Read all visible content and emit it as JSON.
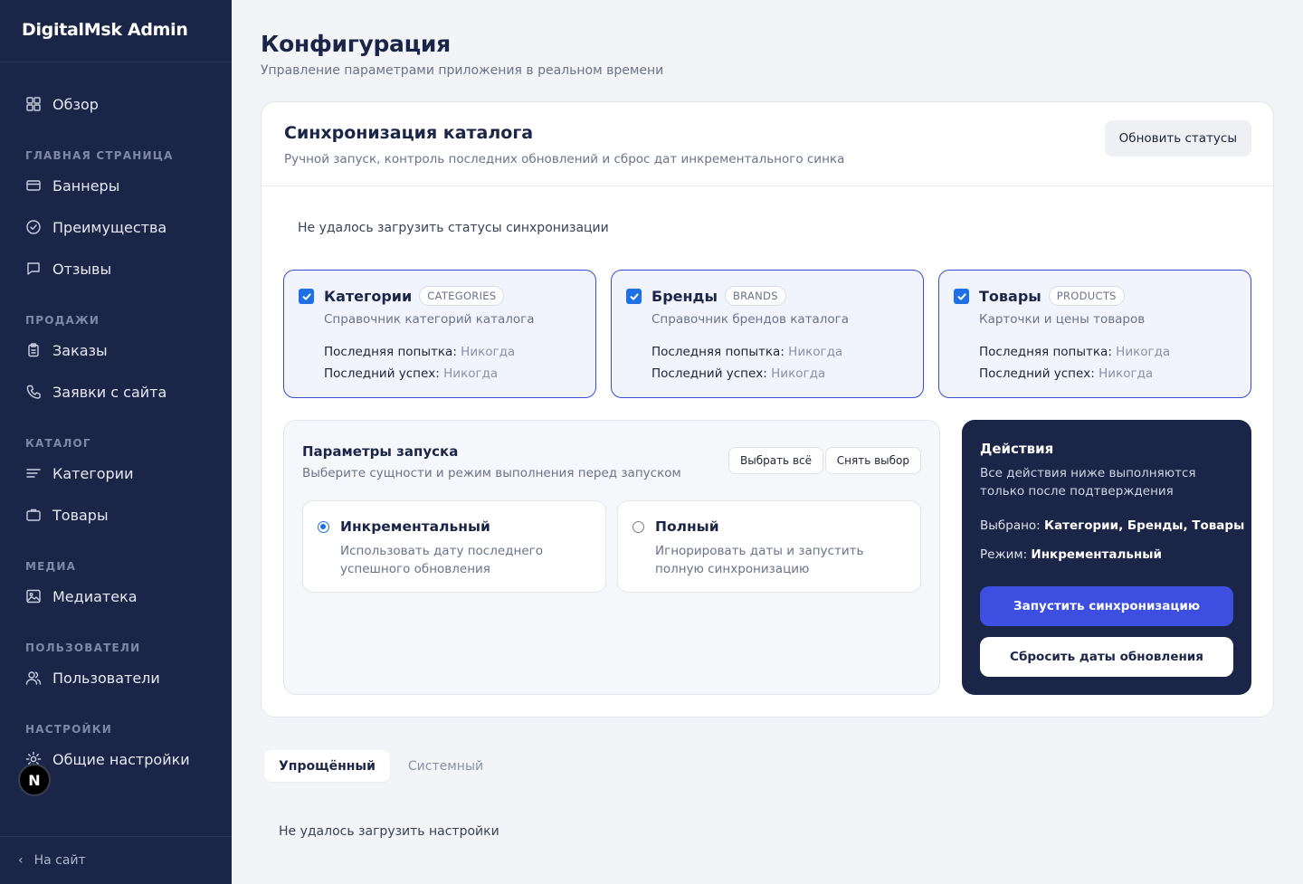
{
  "sidebar": {
    "brand": "DigitalMsk Admin",
    "items": [
      {
        "type": "item",
        "label": "Обзор",
        "icon": "grid-icon"
      },
      {
        "type": "section",
        "label": "ГЛАВНАЯ СТРАНИЦА"
      },
      {
        "type": "item",
        "label": "Баннеры",
        "icon": "banner-icon"
      },
      {
        "type": "item",
        "label": "Преимущества",
        "icon": "check-circle-icon"
      },
      {
        "type": "item",
        "label": "Отзывы",
        "icon": "chat-icon"
      },
      {
        "type": "section",
        "label": "ПРОДАЖИ"
      },
      {
        "type": "item",
        "label": "Заказы",
        "icon": "clipboard-icon"
      },
      {
        "type": "item",
        "label": "Заявки с сайта",
        "icon": "phone-icon"
      },
      {
        "type": "section",
        "label": "КАТАЛОГ"
      },
      {
        "type": "item",
        "label": "Категории",
        "icon": "list-icon"
      },
      {
        "type": "item",
        "label": "Товары",
        "icon": "briefcase-icon"
      },
      {
        "type": "section",
        "label": "МЕДИА"
      },
      {
        "type": "item",
        "label": "Медиатека",
        "icon": "image-icon"
      },
      {
        "type": "section",
        "label": "ПОЛЬЗОВАТЕЛИ"
      },
      {
        "type": "item",
        "label": "Пользователи",
        "icon": "users-icon"
      },
      {
        "type": "section",
        "label": "НАСТРОЙКИ"
      },
      {
        "type": "item",
        "label": "Общие настройки",
        "icon": "gear-icon"
      }
    ],
    "footer_link": "На сайт",
    "badge": "N"
  },
  "page": {
    "title": "Конфигурация",
    "subtitle": "Управление параметрами приложения в реальном времени"
  },
  "sync": {
    "title": "Синхронизация каталога",
    "subtitle": "Ручной запуск, контроль последних обновлений и сброс дат инкрементального синка",
    "refresh_label": "Обновить статусы",
    "error": "Не удалось загрузить статусы синхронизации",
    "last_attempt_label": "Последняя попытка:",
    "last_success_label": "Последний успех:",
    "entities": [
      {
        "name": "Категории",
        "code": "CATEGORIES",
        "desc": "Справочник категорий каталога",
        "last_attempt": "Никогда",
        "last_success": "Никогда",
        "checked": true
      },
      {
        "name": "Бренды",
        "code": "BRANDS",
        "desc": "Справочник брендов каталога",
        "last_attempt": "Никогда",
        "last_success": "Никогда",
        "checked": true
      },
      {
        "name": "Товары",
        "code": "PRODUCTS",
        "desc": "Карточки и цены товаров",
        "last_attempt": "Никогда",
        "last_success": "Никогда",
        "checked": true
      }
    ]
  },
  "params": {
    "title": "Параметры запуска",
    "subtitle": "Выберите сущности и режим выполнения перед запуском",
    "select_all": "Выбрать всё",
    "clear": "Снять выбор",
    "modes": [
      {
        "title": "Инкрементальный",
        "desc": "Использовать дату последнего успешного обновления",
        "selected": true
      },
      {
        "title": "Полный",
        "desc": "Игнорировать даты и запустить полную синхронизацию",
        "selected": false
      }
    ]
  },
  "actions": {
    "title": "Действия",
    "desc": "Все действия ниже выполняются только после подтверждения",
    "selected_label": "Выбрано:",
    "selected_value": "Категории, Бренды, Товары",
    "mode_label": "Режим:",
    "mode_value": "Инкрементальный",
    "run": "Запустить синхронизацию",
    "reset": "Сбросить даты обновления"
  },
  "tabs": [
    {
      "label": "Упрощённый",
      "active": true
    },
    {
      "label": "Системный",
      "active": false
    }
  ],
  "settings_error": "Не удалось загрузить настройки",
  "colors": {
    "sidebar_bg": "#1b2547",
    "accent": "#3c4fe0",
    "checkbox": "#1f6fe5",
    "page_bg": "#f3f4f7"
  }
}
